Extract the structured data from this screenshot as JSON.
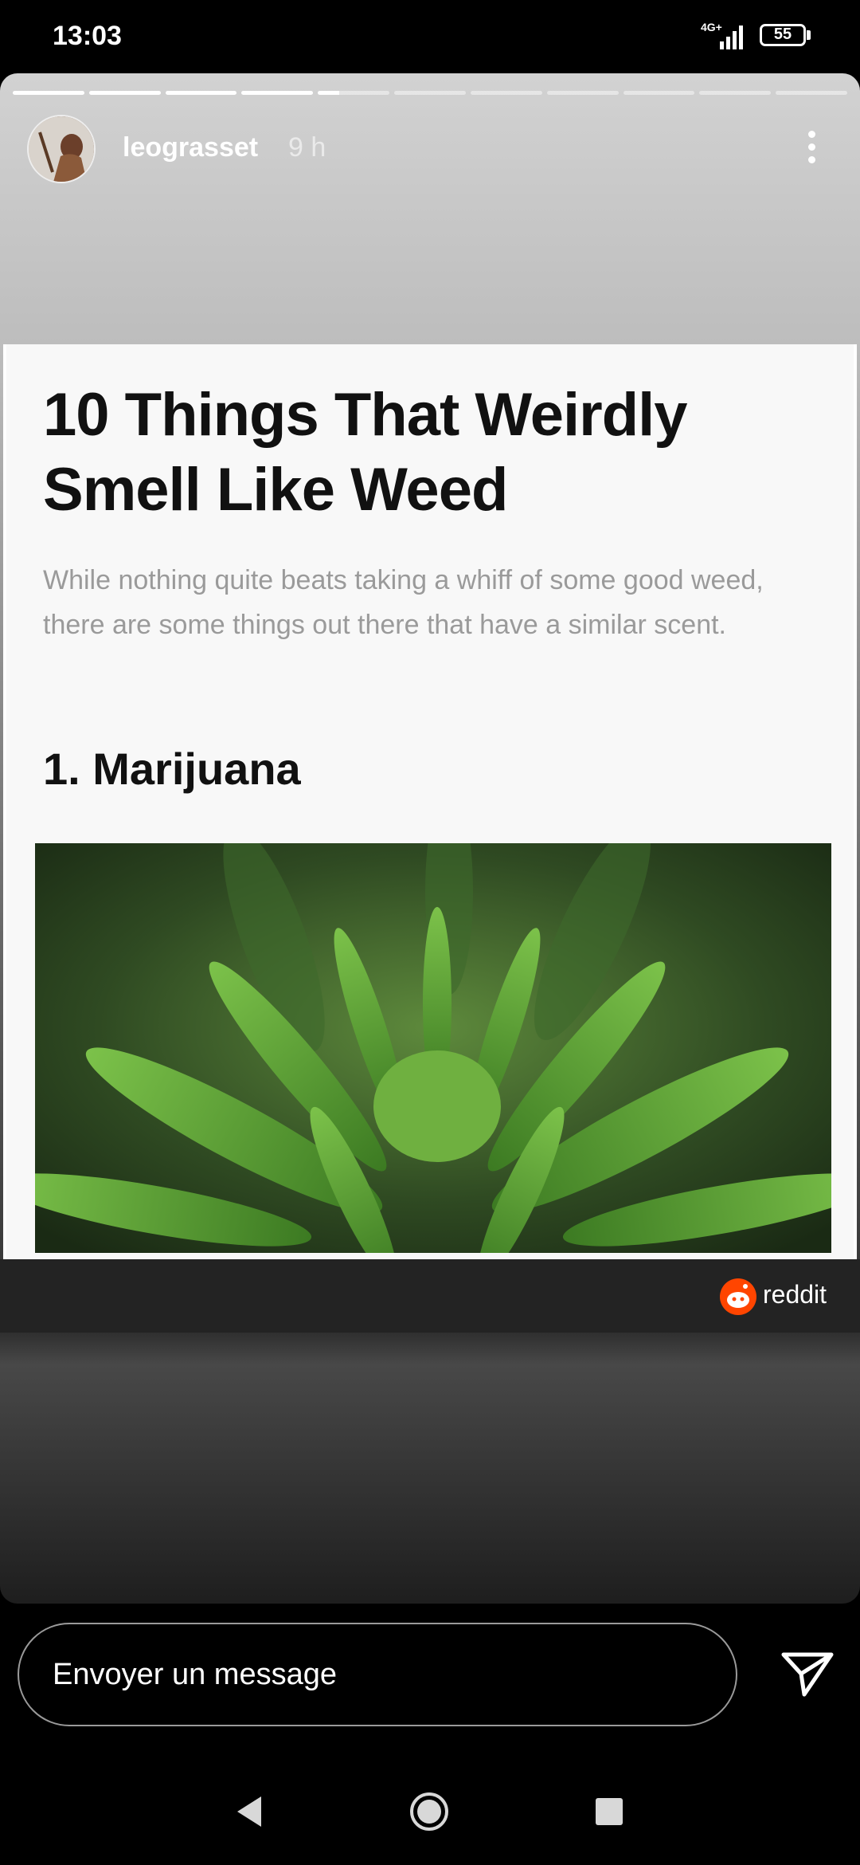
{
  "status_bar": {
    "time": "13:03",
    "network": "4G+",
    "battery": "55"
  },
  "story": {
    "username": "leograsset",
    "time_ago": "9 h",
    "progress": {
      "segments": 11,
      "completed": 4,
      "current_fraction": 0.3
    }
  },
  "article": {
    "title": "10 Things That Weirdly Smell Like Weed",
    "subtitle": "While nothing quite beats taking a whiff of some good weed, there are some things out there that have a similar scent.",
    "heading": "1. Marijuana"
  },
  "credit": {
    "source": "reddit"
  },
  "message": {
    "placeholder": "Envoyer un message"
  },
  "icons": {
    "more": "more-vertical-icon",
    "send": "send-icon",
    "back": "back-icon",
    "home": "home-icon",
    "recents": "recents-icon"
  },
  "colors": {
    "accent_reddit": "#ff4500",
    "plant_green": "#4a9a2a"
  }
}
